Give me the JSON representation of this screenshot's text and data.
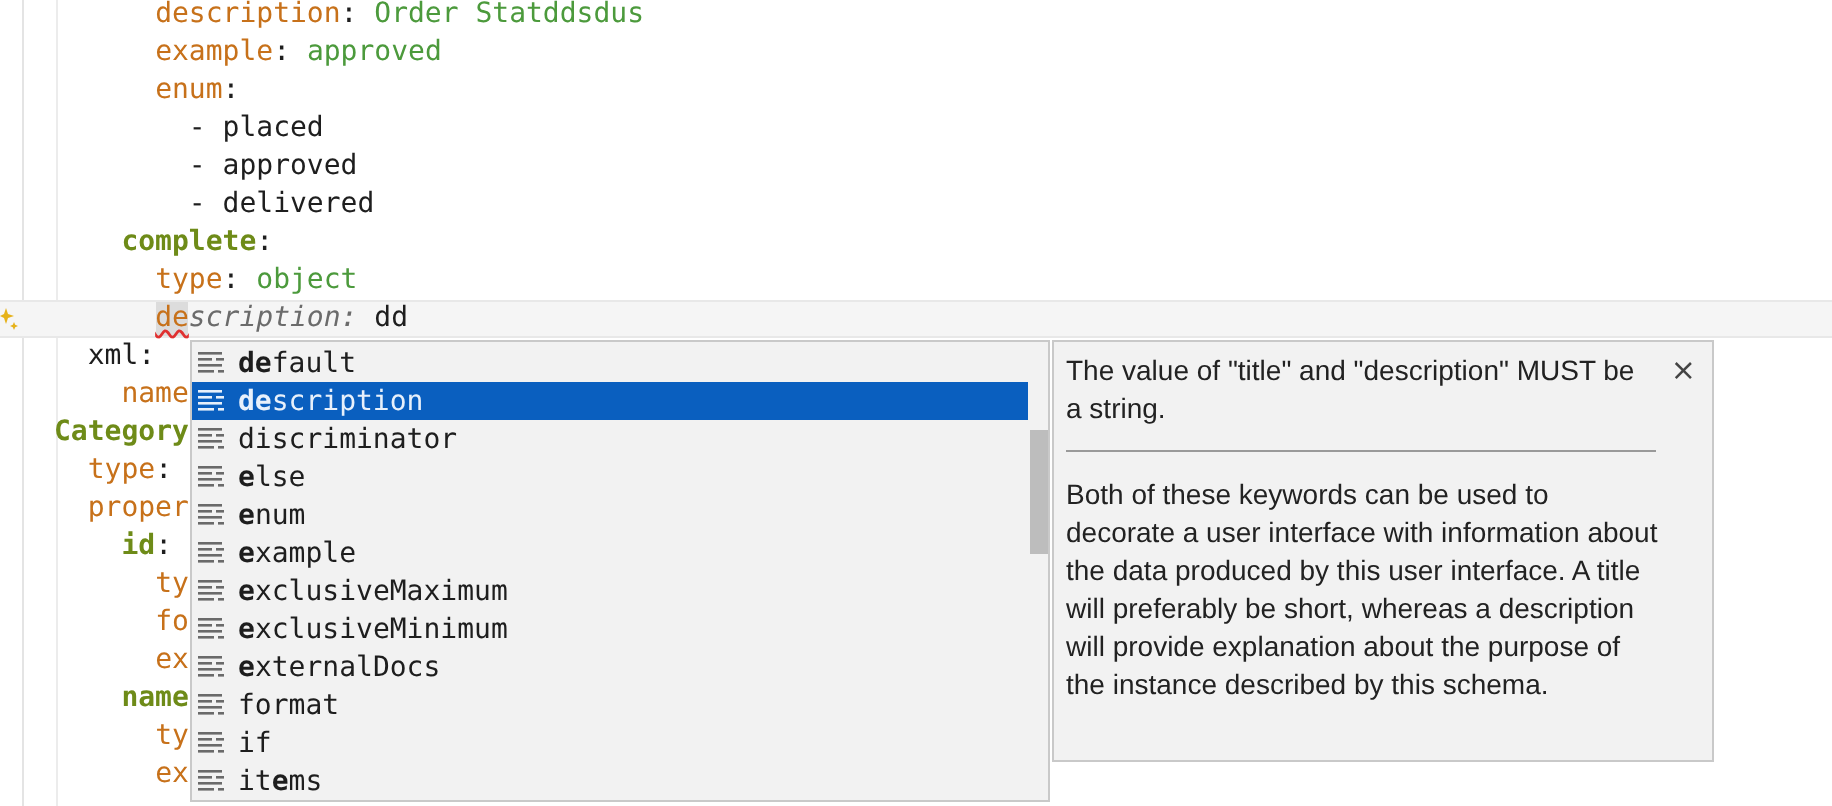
{
  "editor": {
    "lines": [
      {
        "children": [
          {
            "children": [
              {
                "children": [
                  {
                    "tokens": [
                      {
                        "kind": "key",
                        "text": "description"
                      },
                      {
                        "kind": "punct",
                        "text": ": "
                      },
                      {
                        "kind": "value",
                        "text": "Order Statddsdus"
                      }
                    ]
                  },
                  {
                    "tokens": [
                      {
                        "kind": "key",
                        "text": "example"
                      },
                      {
                        "kind": "punct",
                        "text": ": "
                      },
                      {
                        "kind": "value",
                        "text": "approved"
                      }
                    ]
                  },
                  {
                    "tokens": [
                      {
                        "kind": "key",
                        "text": "enum"
                      },
                      {
                        "kind": "punct",
                        "text": ":"
                      }
                    ],
                    "children": [
                      {
                        "tokens": [
                          {
                            "kind": "plain",
                            "text": "- placed"
                          }
                        ]
                      },
                      {
                        "tokens": [
                          {
                            "kind": "plain",
                            "text": "- approved"
                          }
                        ]
                      },
                      {
                        "tokens": [
                          {
                            "kind": "plain",
                            "text": "- delivered"
                          }
                        ]
                      }
                    ]
                  }
                ]
              },
              {
                "tokens": [
                  {
                    "kind": "section",
                    "text": "complete"
                  },
                  {
                    "kind": "punct",
                    "text": ":"
                  }
                ],
                "children": [
                  {
                    "tokens": [
                      {
                        "kind": "key",
                        "text": "type"
                      },
                      {
                        "kind": "punct",
                        "text": ": "
                      },
                      {
                        "kind": "value",
                        "text": "object"
                      }
                    ]
                  },
                  {
                    "current": true,
                    "tokens": [
                      {
                        "kind": "typed",
                        "text": "de"
                      },
                      {
                        "kind": "hint",
                        "text": "scription: "
                      },
                      {
                        "kind": "plain",
                        "text": "dd"
                      }
                    ]
                  }
                ]
              }
            ]
          },
          {
            "tokens": [
              {
                "kind": "plain",
                "text": "xml:"
              }
            ],
            "children": [
              {
                "tokens": [
                  {
                    "kind": "key",
                    "text": "name"
                  }
                ]
              }
            ]
          }
        ]
      },
      {
        "tokens": [
          {
            "kind": "section",
            "text": "Category"
          }
        ],
        "children": [
          {
            "tokens": [
              {
                "kind": "key",
                "text": "type"
              },
              {
                "kind": "punct",
                "text": ":"
              }
            ]
          },
          {
            "tokens": [
              {
                "kind": "key",
                "text": "proper"
              }
            ],
            "children": [
              {
                "tokens": [
                  {
                    "kind": "section",
                    "text": "id"
                  },
                  {
                    "kind": "punct",
                    "text": ":"
                  }
                ],
                "children": [
                  {
                    "tokens": [
                      {
                        "kind": "key",
                        "text": "ty"
                      }
                    ]
                  },
                  {
                    "tokens": [
                      {
                        "kind": "key",
                        "text": "fo"
                      }
                    ]
                  },
                  {
                    "tokens": [
                      {
                        "kind": "key",
                        "text": "ex"
                      }
                    ]
                  }
                ]
              },
              {
                "tokens": [
                  {
                    "kind": "section",
                    "text": "name"
                  }
                ],
                "children": [
                  {
                    "tokens": [
                      {
                        "kind": "key",
                        "text": "ty"
                      }
                    ]
                  },
                  {
                    "tokens": [
                      {
                        "kind": "key",
                        "text": "ex"
                      }
                    ]
                  }
                ]
              }
            ]
          }
        ]
      }
    ]
  },
  "completion": {
    "items": [
      {
        "label": "**de**fault",
        "selected": false
      },
      {
        "label": "**de**scription",
        "selected": true
      },
      {
        "label": "discriminator",
        "selected": false
      },
      {
        "label": "**e**lse",
        "selected": false
      },
      {
        "label": "**e**num",
        "selected": false
      },
      {
        "label": "**e**xample",
        "selected": false
      },
      {
        "label": "**e**xclusiveMaximum",
        "selected": false
      },
      {
        "label": "**e**xclusiveMinimum",
        "selected": false
      },
      {
        "label": "**e**xternalDocs",
        "selected": false
      },
      {
        "label": "format",
        "selected": false
      },
      {
        "label": "if",
        "selected": false
      },
      {
        "label": "it**e**ms",
        "selected": false
      }
    ]
  },
  "documentation": {
    "summary": "The value of \"title\" and \"description\" MUST be a string.",
    "close": "×",
    "body": "Both of these keywords can be used to decorate a user interface with information about the data produced by this user interface. A title will preferably be short, whereas a description will provide explanation about the purpose of the instance described by this schema."
  }
}
